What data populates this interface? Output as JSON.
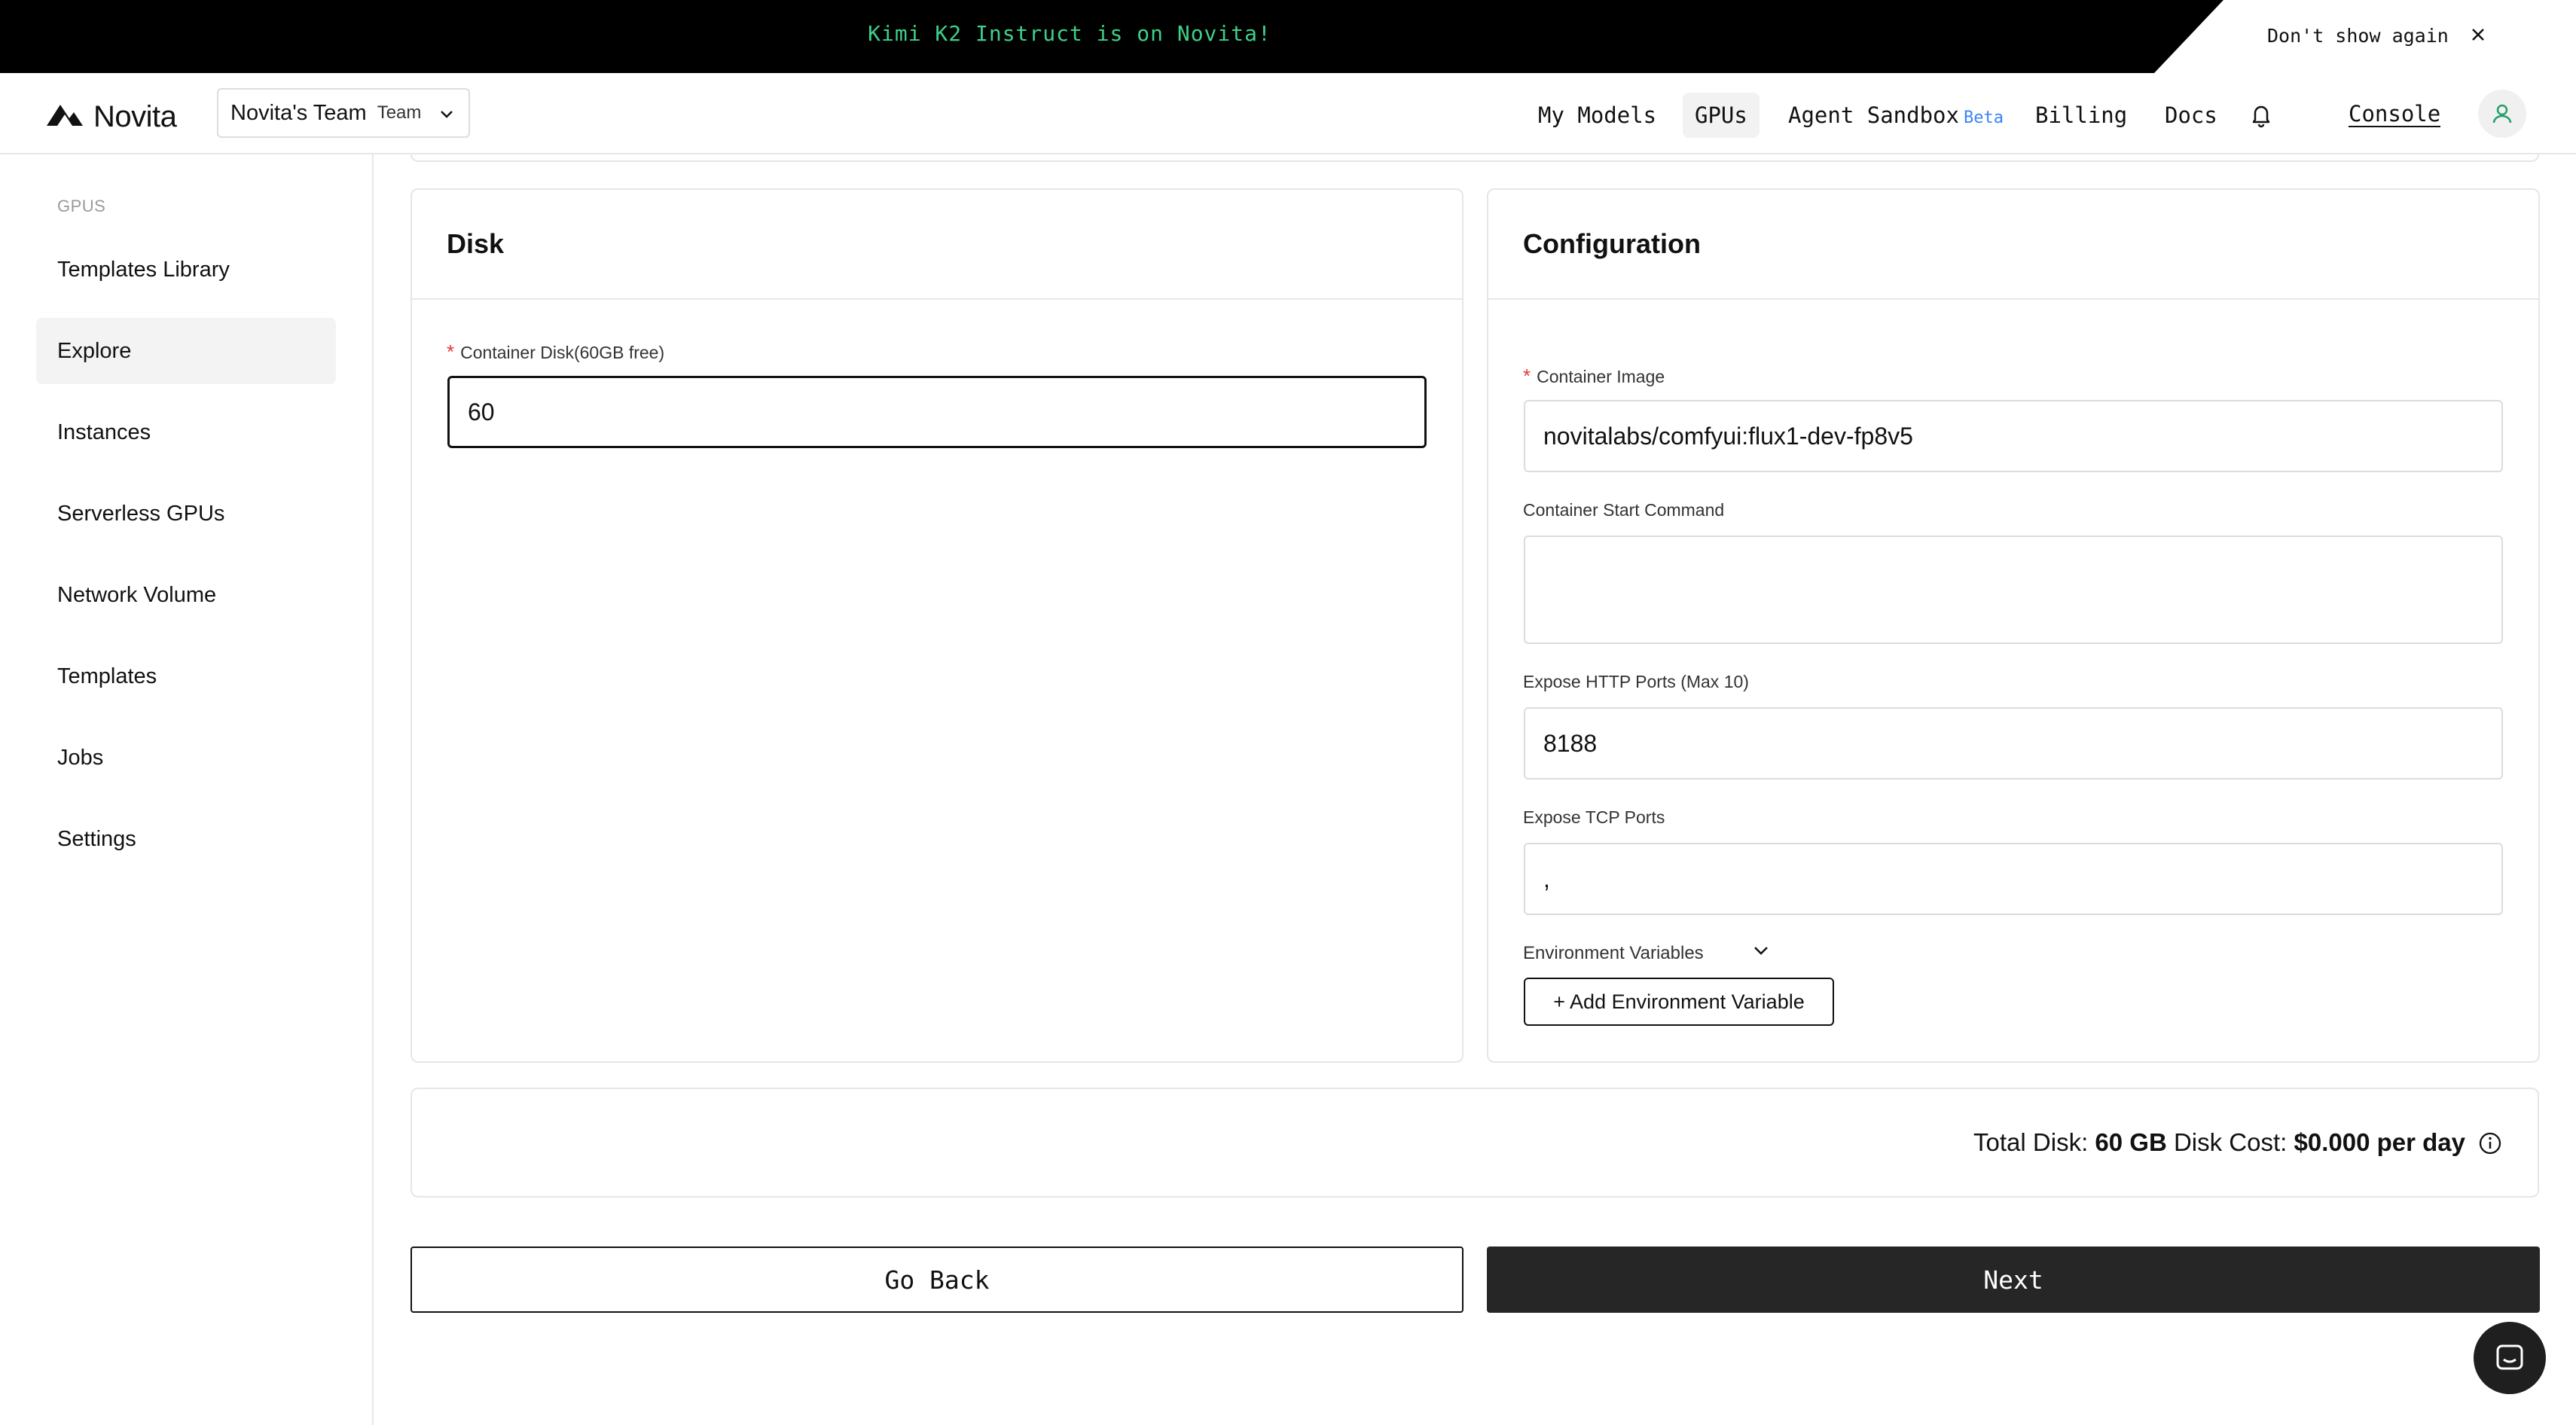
{
  "banner": {
    "message": "Kimi K2 Instruct is on Novita!",
    "dont_show": "Don't show again"
  },
  "header": {
    "logo_text": "Novita",
    "team_name": "Novita's Team",
    "team_tag": "Team",
    "nav": [
      "My Models",
      "GPUs",
      "Agent Sandbox",
      "Billing",
      "Docs"
    ],
    "beta_label": "Beta",
    "active_nav": "GPUs",
    "console_label": "Console"
  },
  "sidebar": {
    "section": "GPUS",
    "items": [
      "Templates Library",
      "Explore",
      "Instances",
      "Serverless GPUs",
      "Network Volume",
      "Templates",
      "Jobs",
      "Settings"
    ],
    "active": "Explore"
  },
  "disk_card": {
    "title": "Disk",
    "container_disk_label": "Container Disk(60GB free)",
    "container_disk_value": "60"
  },
  "config_card": {
    "title": "Configuration",
    "image_label": "Container Image",
    "image_value": "novitalabs/comfyui:flux1-dev-fp8v5",
    "start_cmd_label": "Container Start Command",
    "start_cmd_value": "",
    "http_ports_label": "Expose HTTP Ports (Max 10)",
    "http_ports_value": "8188",
    "tcp_ports_label": "Expose TCP Ports",
    "tcp_ports_value": ",",
    "env_label": "Environment Variables",
    "add_env_label": "+ Add Environment Variable"
  },
  "summary": {
    "total_disk_label": "Total Disk:",
    "total_disk_value": "60 GB",
    "disk_cost_label": "Disk Cost:",
    "disk_cost_value": "$0.000 per day"
  },
  "actions": {
    "back_label": "Go Back",
    "next_label": "Next"
  },
  "colors": {
    "banner_text": "#3ed08a",
    "beta": "#3b82f6",
    "required": "#e53935",
    "next_bg": "#262626"
  }
}
